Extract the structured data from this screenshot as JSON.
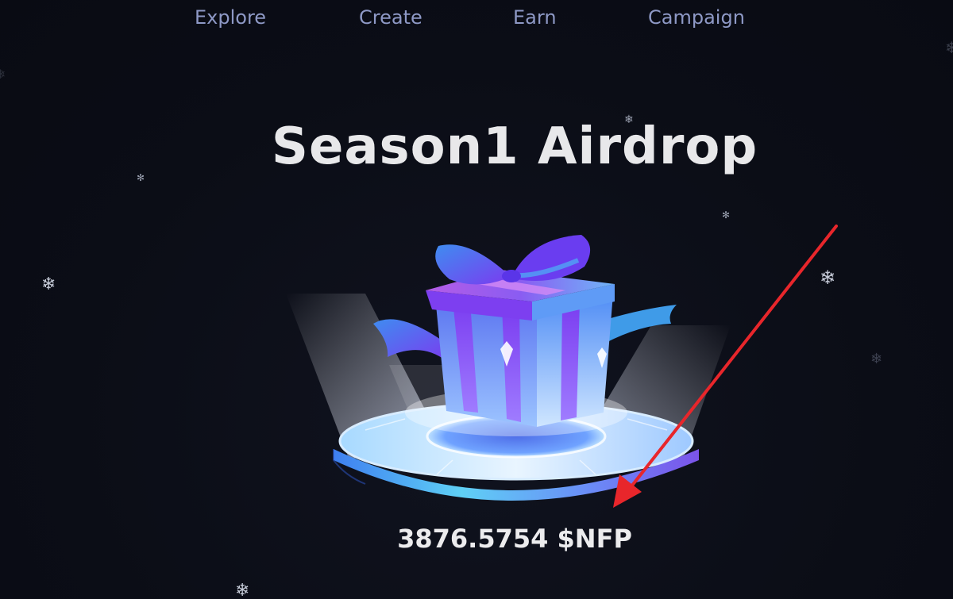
{
  "nav": {
    "items": [
      {
        "label": "Explore"
      },
      {
        "label": "Create"
      },
      {
        "label": "Earn"
      },
      {
        "label": "Campaign"
      }
    ]
  },
  "hero": {
    "title": "Season1 Airdrop",
    "amount": "3876.5754 $NFP"
  },
  "icons": {
    "snowflake": "snowflake-icon",
    "gift": "gift-box-illustration",
    "annotation": "red-arrow-annotation"
  },
  "colors": {
    "background": "#0b0d16",
    "nav_text": "#8e99c6",
    "title_text": "#e8e8ea",
    "arrow": "#e8262b",
    "gift_purple": "#6a3df0",
    "gift_blue": "#4f8cf5",
    "pedestal_cyan": "#5fd0f5"
  }
}
